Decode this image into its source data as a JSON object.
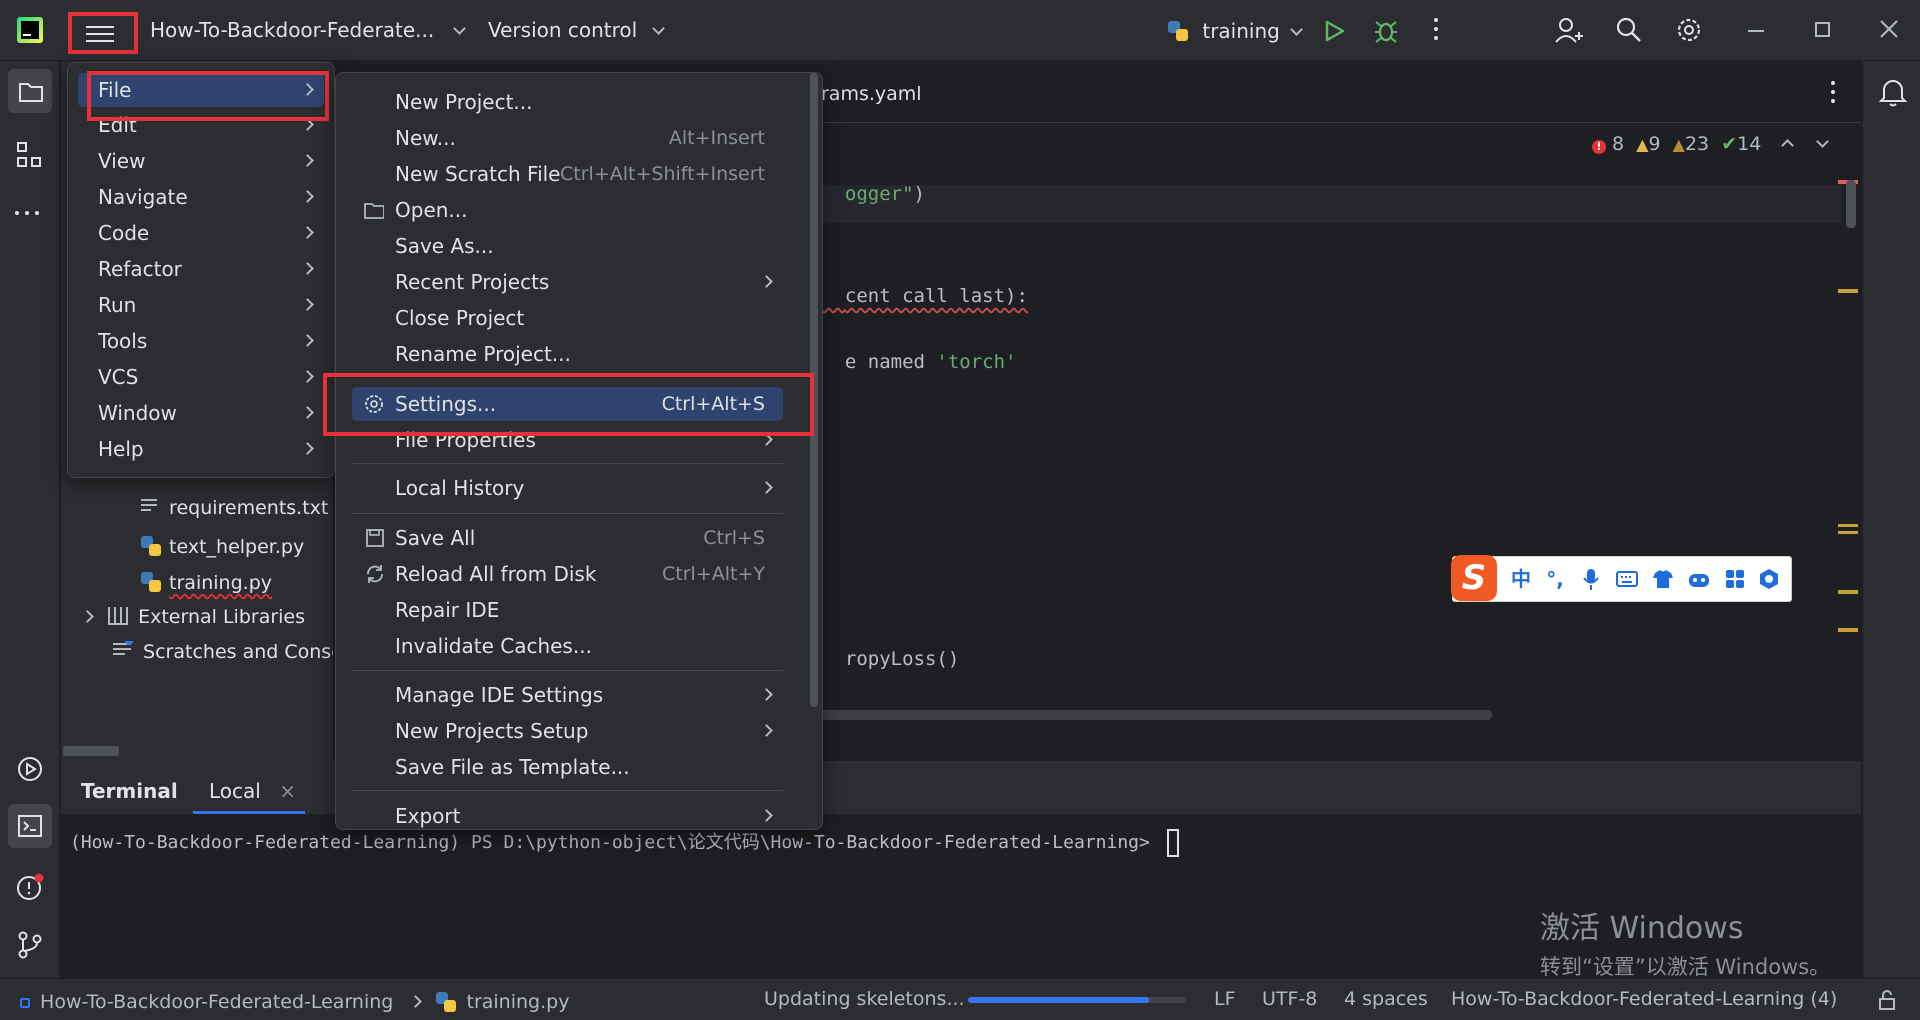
{
  "titlebar": {
    "project_name": "How-To-Backdoor-Federate...",
    "vcs_label": "Version control",
    "run_config": "training"
  },
  "editor": {
    "tab_label": "rams.yaml",
    "inspections": {
      "errors": "8",
      "warnings": "9",
      "weak_warnings": "23",
      "ok": "14"
    },
    "code_lines": [
      {
        "text": "ogger\")",
        "parts": [
          {
            "t": "ogger\"",
            "c": "#6aab73"
          },
          {
            "t": ")",
            "c": "#bcbec4"
          }
        ]
      },
      {
        "text": "cent call last):"
      },
      {
        "text": "e named 'torch'",
        "parts": [
          {
            "t": "e named ",
            "c": "#bcbec4"
          },
          {
            "t": "'torch'",
            "c": "#6aab73"
          }
        ]
      },
      {
        "text": "ropyLoss()"
      }
    ]
  },
  "project_tree": {
    "items": [
      {
        "label": "requirements.txt",
        "icon": "text-file-icon"
      },
      {
        "label": "text_helper.py",
        "icon": "python-file-icon"
      },
      {
        "label": "training.py",
        "icon": "python-file-icon"
      },
      {
        "label": "External Libraries",
        "icon": "library-icon"
      },
      {
        "label": "Scratches and Conso",
        "icon": "scratches-icon"
      }
    ]
  },
  "main_menu": {
    "items": [
      "File",
      "Edit",
      "View",
      "Navigate",
      "Code",
      "Refactor",
      "Run",
      "Tools",
      "VCS",
      "Window",
      "Help"
    ]
  },
  "file_menu": {
    "items": [
      {
        "label": "New Project...",
        "shortcut": ""
      },
      {
        "label": "New...",
        "shortcut": "Alt+Insert"
      },
      {
        "label": "New Scratch File",
        "shortcut": "Ctrl+Alt+Shift+Insert"
      },
      {
        "label": "Open...",
        "shortcut": ""
      },
      {
        "label": "Save As...",
        "shortcut": ""
      },
      {
        "label": "Recent Projects",
        "shortcut": ""
      },
      {
        "label": "Close Project",
        "shortcut": ""
      },
      {
        "label": "Rename Project...",
        "shortcut": ""
      },
      {
        "label": "Settings...",
        "shortcut": "Ctrl+Alt+S"
      },
      {
        "label": "File Properties",
        "shortcut": ""
      },
      {
        "label": "Local History",
        "shortcut": ""
      },
      {
        "label": "Save All",
        "shortcut": "Ctrl+S"
      },
      {
        "label": "Reload All from Disk",
        "shortcut": "Ctrl+Alt+Y"
      },
      {
        "label": "Repair IDE",
        "shortcut": ""
      },
      {
        "label": "Invalidate Caches...",
        "shortcut": ""
      },
      {
        "label": "Manage IDE Settings",
        "shortcut": ""
      },
      {
        "label": "New Projects Setup",
        "shortcut": ""
      },
      {
        "label": "Save File as Template...",
        "shortcut": ""
      },
      {
        "label": "Export",
        "shortcut": ""
      }
    ]
  },
  "terminal": {
    "title": "Terminal",
    "tab": "Local",
    "prompt": "(How-To-Backdoor-Federated-Learning) PS D:\\python-object\\论文代码\\How-To-Backdoor-Federated-Learning>"
  },
  "watermark": {
    "line1": "激活 Windows",
    "line2": "转到“设置”以激活 Windows。"
  },
  "statusbar": {
    "project": "How-To-Backdoor-Federated-Learning",
    "file": "training.py",
    "task": "Updating skeletons...",
    "progress": 0.83,
    "line_sep": "LF",
    "encoding": "UTF-8",
    "indent": "4 spaces",
    "interpreter": "How-To-Backdoor-Federated-Learning (4)"
  },
  "ime": {
    "logo": "S",
    "mode": "中",
    "punct": "°,"
  },
  "colors": {
    "accent": "#3574f0",
    "highlight_box": "#e5323a",
    "selection": "#2e436e",
    "string_green": "#6aab73"
  }
}
